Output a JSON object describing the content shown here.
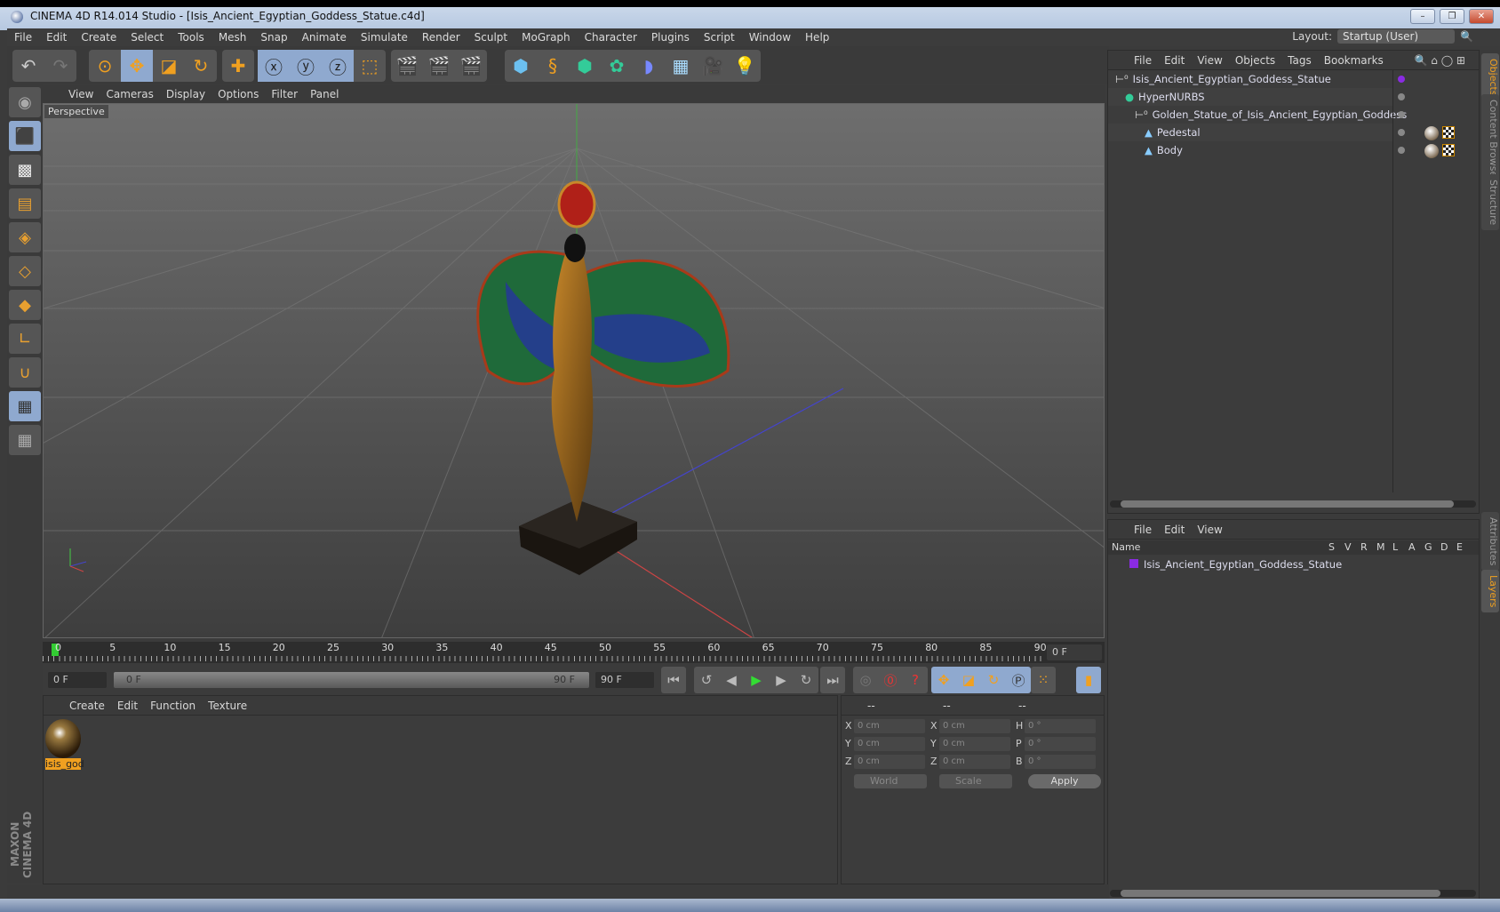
{
  "window": {
    "title": "CINEMA 4D R14.014 Studio - [Isis_Ancient_Egyptian_Goddess_Statue.c4d]",
    "min": "–",
    "max": "❐",
    "close": "✕"
  },
  "menu": [
    "File",
    "Edit",
    "Create",
    "Select",
    "Tools",
    "Mesh",
    "Snap",
    "Animate",
    "Simulate",
    "Render",
    "Sculpt",
    "MoGraph",
    "Character",
    "Plugins",
    "Script",
    "Window",
    "Help"
  ],
  "layout": {
    "label": "Layout:",
    "value": "Startup (User)"
  },
  "viewport": {
    "menu": [
      "View",
      "Cameras",
      "Display",
      "Options",
      "Filter",
      "Panel"
    ],
    "label": "Perspective"
  },
  "timeline": {
    "ticks": [
      "0",
      "5",
      "10",
      "15",
      "20",
      "25",
      "30",
      "35",
      "40",
      "45",
      "50",
      "55",
      "60",
      "65",
      "70",
      "75",
      "80",
      "85",
      "90"
    ],
    "current": "0 F",
    "start": "0 F",
    "range_start": "0 F",
    "range_end": "90 F",
    "end": "90 F"
  },
  "materials": {
    "menu": [
      "Create",
      "Edit",
      "Function",
      "Texture"
    ],
    "items": [
      {
        "name": "isis_god"
      }
    ]
  },
  "coords": {
    "headers": [
      "--",
      "--",
      "--"
    ],
    "rows": [
      {
        "a": "X",
        "av": "0 cm",
        "b": "X",
        "bv": "0 cm",
        "c": "H",
        "cv": "0 °"
      },
      {
        "a": "Y",
        "av": "0 cm",
        "b": "Y",
        "bv": "0 cm",
        "c": "P",
        "cv": "0 °"
      },
      {
        "a": "Z",
        "av": "0 cm",
        "b": "Z",
        "bv": "0 cm",
        "c": "B",
        "cv": "0 °"
      }
    ],
    "world": "World",
    "scale": "Scale",
    "apply": "Apply"
  },
  "objects": {
    "menu": [
      "File",
      "Edit",
      "View",
      "Objects",
      "Tags",
      "Bookmarks"
    ],
    "tree": [
      {
        "name": "Isis_Ancient_Egyptian_Goddess_Statue",
        "depth": 0,
        "icon": "null-icon"
      },
      {
        "name": "HyperNURBS",
        "depth": 1,
        "icon": "hypernurbs-icon"
      },
      {
        "name": "Golden_Statue_of_Isis_Ancient_Egyptian_Goddess",
        "depth": 2,
        "icon": "null-icon"
      },
      {
        "name": "Pedestal",
        "depth": 3,
        "icon": "polygon-icon"
      },
      {
        "name": "Body",
        "depth": 3,
        "icon": "polygon-icon"
      }
    ]
  },
  "layers": {
    "menu": [
      "File",
      "Edit",
      "View"
    ],
    "columns": [
      "Name",
      "S",
      "V",
      "R",
      "M",
      "L",
      "A",
      "G",
      "D",
      "E"
    ],
    "rows": [
      {
        "name": "Isis_Ancient_Egyptian_Goddess_Statue",
        "color": "#8a2be2"
      }
    ]
  },
  "side_tabs": [
    "Objects",
    "Content Browser",
    "Structure",
    "Attributes",
    "Layers"
  ],
  "brand": "MAXON CINEMA 4D",
  "colors": {
    "accent": "#f0a020",
    "selected": "#8fa9cf",
    "layer": "#8a2be2"
  }
}
